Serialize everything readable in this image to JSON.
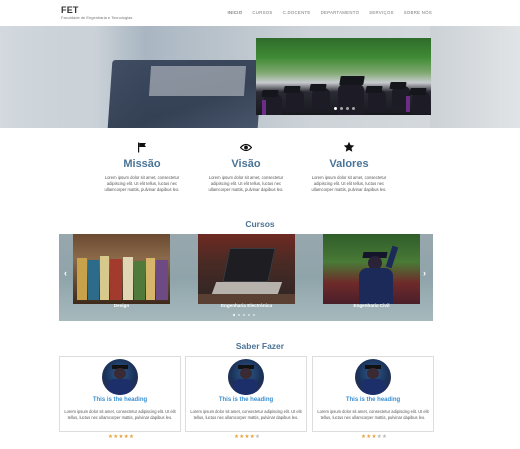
{
  "brand": {
    "title": "FET",
    "subtitle": "Faculdade de Engenharia e Tecnologias"
  },
  "nav": {
    "items": [
      {
        "label": "INICIO"
      },
      {
        "label": "CURSOS"
      },
      {
        "label": "C.DOCENTE"
      },
      {
        "label": "DEPARTAMENTO"
      },
      {
        "label": "SERVIÇOS"
      },
      {
        "label": "SOBRE NÓS"
      }
    ],
    "active_index": 0
  },
  "hero": {
    "carousel_slides": 4,
    "active_slide": 0
  },
  "features": [
    {
      "icon": "flag-icon",
      "title": "Missão",
      "text": "Lorem ipsum dolor sit amet, consectetur adipiscing elit. Ut elit tellus, luctus nec ullamcorper mattis, pulvinar dapibus leo."
    },
    {
      "icon": "eye-icon",
      "title": "Visão",
      "text": "Lorem ipsum dolor sit amet, consectetur adipiscing elit. Ut elit tellus, luctus nec ullamcorper mattis, pulvinar dapibus leo."
    },
    {
      "icon": "star-icon",
      "title": "Valores",
      "text": "Lorem ipsum dolor sit amet, consectetur adipiscing elit. Ut elit tellus, luctus nec ullamcorper mattis, pulvinar dapibus leo."
    }
  ],
  "cursos": {
    "title": "Cursos",
    "items": [
      {
        "label": "Design"
      },
      {
        "label": "Engenharia Electrónica"
      },
      {
        "label": "Engenharia Civil"
      }
    ],
    "prev_arrow": "‹",
    "next_arrow": "›",
    "dots": 5,
    "active_dot": 0
  },
  "saber_fazer": {
    "title": "Saber Fazer",
    "cards": [
      {
        "heading": "This is the heading",
        "text": "Lorem ipsum dolor sit amet, consectetur adipiscing elit. Ut elit tellus, luctus nec ullamcorper mattis, pulvinar dapibus leo.",
        "rating": 5
      },
      {
        "heading": "This is the heading",
        "text": "Lorem ipsum dolor sit amet, consectetur adipiscing elit. Ut elit tellus, luctus nec ullamcorper mattis, pulvinar dapibus leo.",
        "rating": 4
      },
      {
        "heading": "This is the heading",
        "text": "Lorem ipsum dolor sit amet, consectetur adipiscing elit. Ut elit tellus, luctus nec ullamcorper mattis, pulvinar dapibus leo.",
        "rating": 2.5
      }
    ]
  },
  "colors": {
    "accent": "#4a7396",
    "heading_link": "#3a8fd0",
    "star": "#e6a23c"
  }
}
